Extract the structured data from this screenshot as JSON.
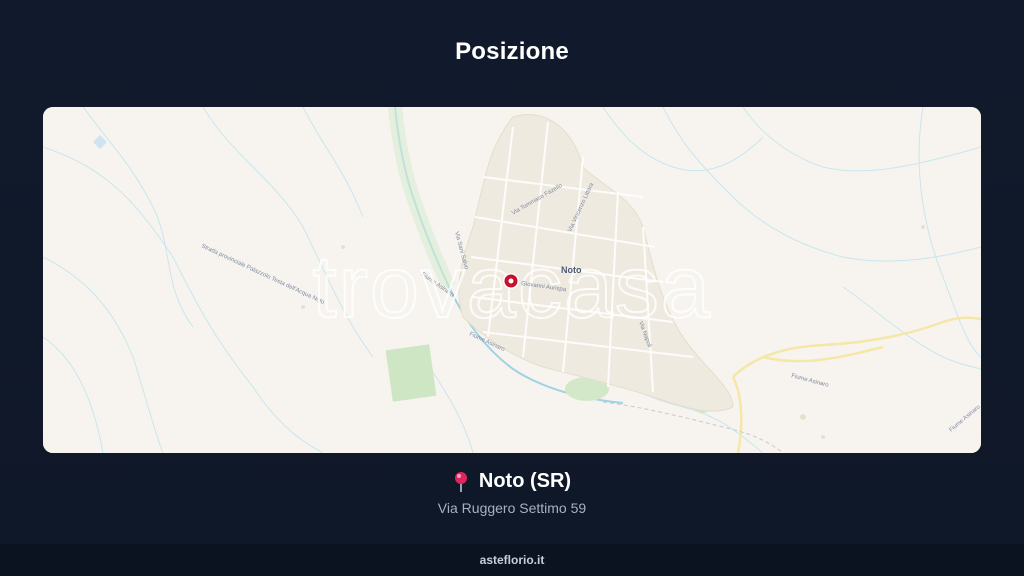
{
  "header": {
    "title": "Posizione"
  },
  "map": {
    "watermark": "trovacasa",
    "town_label": "Noto",
    "marker_street_label": "Giovanni Aurispa",
    "street_labels": {
      "tommaso_fazello": "Via Tommaso Fazello",
      "vincenzo_littara": "Via Vincenzo Littara",
      "sani_salvo": "Via Sani Salvo",
      "napoli": "Via Napoli",
      "provinciale": "Strada provinciale Palazzolo Testa dell'Acqua Noto",
      "fiume_asinaro_1": "Fiume Asinaro",
      "fiume_asinaro_2": "Fiume Asinaro",
      "fiume_asinaro_3": "Fiume Asinaro",
      "fiume_asinaro_4": "Fiume Asinaro"
    },
    "colors": {
      "background": "#f7f4ef",
      "marker": "#c8102e",
      "river": "#9fd3e3",
      "green": "#cfe6c4",
      "road": "#f5e7a8"
    }
  },
  "location": {
    "pin_icon": "round-pushpin-icon",
    "city": "Noto (SR)",
    "address": "Via Ruggero Settimo 59"
  },
  "footer": {
    "site": "asteflorio.it"
  }
}
